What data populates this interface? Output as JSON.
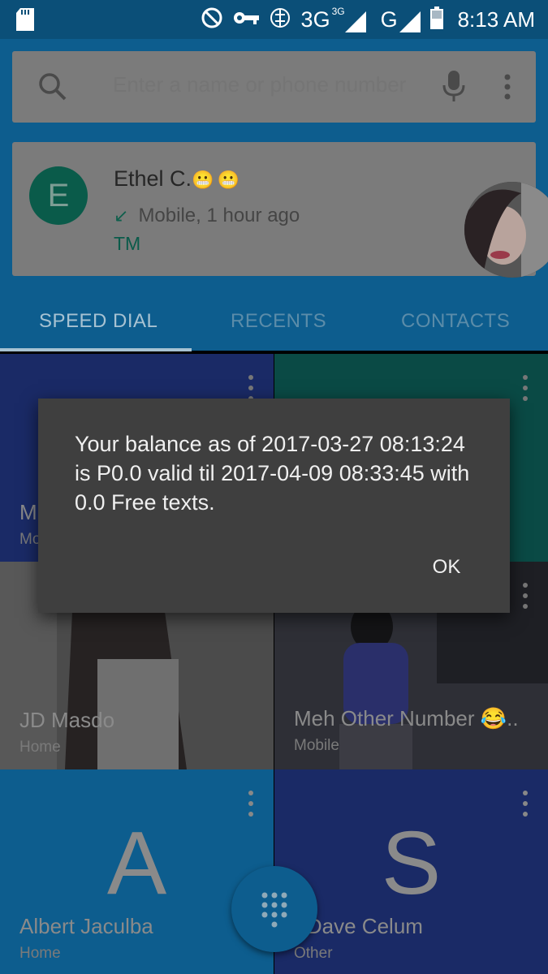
{
  "status_bar": {
    "network_3g": "3G",
    "network_3g_sup": "3G",
    "network_g": "G",
    "time": "8:13 AM",
    "icons": [
      "sd-card-icon",
      "do-not-disturb-icon",
      "vpn-key-icon",
      "data-sync-icon",
      "signal-icon",
      "battery-icon"
    ]
  },
  "search": {
    "placeholder": "Enter a name or phone number"
  },
  "recent": {
    "avatar_letter": "E",
    "name": "Ethel C.",
    "emoji": "😬😬",
    "arrow": "↙",
    "detail": "Mobile, 1 hour ago",
    "carrier": "TM"
  },
  "tabs": [
    {
      "label": "SPEED DIAL",
      "selected": true
    },
    {
      "label": "RECENTS",
      "selected": false
    },
    {
      "label": "CONTACTS",
      "selected": false
    }
  ],
  "speed_dial": [
    {
      "name": "M",
      "type": "Mo"
    },
    {
      "name": "",
      "type": ""
    },
    {
      "name": "JD Masdo",
      "type": "Home"
    },
    {
      "name": "Meh Other Number 😂..",
      "type": "Mobile"
    },
    {
      "letter": "A",
      "name": "Albert Jaculba",
      "type": "Home"
    },
    {
      "letter": "S",
      "name": "r Dave Celum",
      "type": "Other"
    }
  ],
  "dialog": {
    "message": "Your balance as of 2017-03-27 08:13:24 is P0.0 valid til 2017-04-09 08:33:45 with 0.0 Free texts.",
    "ok_label": "OK"
  },
  "colors": {
    "app_bar": "#0d5d8e",
    "status_bar": "#0b4f78",
    "dialog_bg": "#3f3f3f",
    "avatar_green": "#0a5b4a"
  }
}
